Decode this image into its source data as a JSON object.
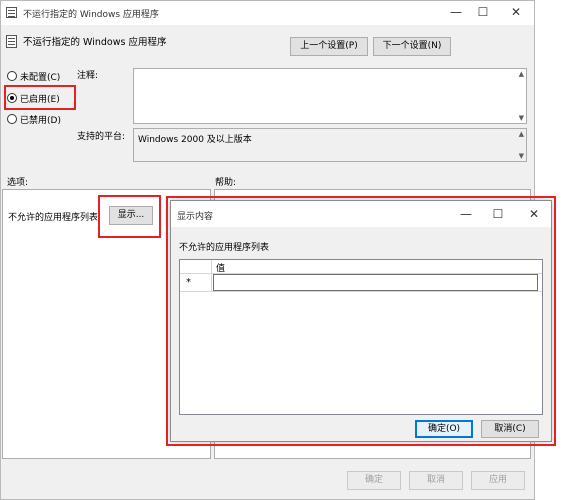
{
  "main_window": {
    "title": "不运行指定的 Windows 应用程序",
    "policy_title": "不运行指定的 Windows 应用程序",
    "prev_setting": "上一个设置(P)",
    "next_setting": "下一个设置(N)",
    "minimize": "—",
    "maximize": "☐",
    "close": "✕",
    "radios": [
      {
        "label": "未配置(C)",
        "checked": false
      },
      {
        "label": "已启用(E)",
        "checked": true
      },
      {
        "label": "已禁用(D)",
        "checked": false
      }
    ],
    "comment_label": "注释:",
    "platform_label": "支持的平台:",
    "platform_value": "Windows 2000 及以上版本",
    "options_label": "选项:",
    "help_label": "帮助:",
    "option_list_label": "不允许的应用程序列表",
    "show_button": "显示...",
    "ok": "确定",
    "cancel": "取消",
    "apply": "应用"
  },
  "dialog": {
    "title": "显示内容",
    "minimize": "—",
    "maximize": "☐",
    "close": "✕",
    "list_label": "不允许的应用程序列表",
    "column_header": "值",
    "new_row_marker": "*",
    "ok": "确定(O)",
    "cancel": "取消(C)"
  },
  "colors": {
    "highlight": "#e02424",
    "accent": "#0078d7"
  }
}
